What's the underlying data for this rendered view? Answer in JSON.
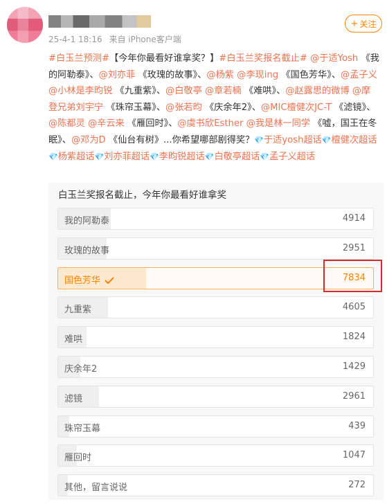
{
  "post": {
    "meta": {
      "date": "25-4-1 18:16",
      "source": "来自 iPhone客户端"
    },
    "follow_label": "关注",
    "content": [
      {
        "t": "tag",
        "v": "#白玉兰预测#"
      },
      {
        "t": "text",
        "v": "【今年你最看好谁拿奖？】"
      },
      {
        "t": "tag",
        "v": "#白玉兰奖报名截止#"
      },
      {
        "t": "text",
        "v": " "
      },
      {
        "t": "mention",
        "v": "@于适Yosh"
      },
      {
        "t": "text",
        "v": " 《我的阿勒泰》、"
      },
      {
        "t": "mention",
        "v": "@刘亦菲"
      },
      {
        "t": "text",
        "v": " 《玫瑰的故事》、"
      },
      {
        "t": "mention",
        "v": "@杨紫"
      },
      {
        "t": "text",
        "v": " "
      },
      {
        "t": "mention",
        "v": "@李现ing"
      },
      {
        "t": "text",
        "v": " 《国色芳华》、"
      },
      {
        "t": "mention",
        "v": "@孟子义"
      },
      {
        "t": "text",
        "v": " "
      },
      {
        "t": "mention",
        "v": "@小林是李昀锐"
      },
      {
        "t": "text",
        "v": " 《九重紫》、"
      },
      {
        "t": "mention",
        "v": "@白敬亭"
      },
      {
        "t": "text",
        "v": " "
      },
      {
        "t": "mention",
        "v": "@章若楠"
      },
      {
        "t": "text",
        "v": " 《难哄》、"
      },
      {
        "t": "mention",
        "v": "@赵露思的微博"
      },
      {
        "t": "text",
        "v": " "
      },
      {
        "t": "mention",
        "v": "@摩登兄弟刘宇宁"
      },
      {
        "t": "text",
        "v": " 《珠帘玉幕》、"
      },
      {
        "t": "mention",
        "v": "@张若昀"
      },
      {
        "t": "text",
        "v": " 《庆余年2》、"
      },
      {
        "t": "mention",
        "v": "@MIC檀健次JC-T"
      },
      {
        "t": "text",
        "v": " 《滤镜》、"
      },
      {
        "t": "mention",
        "v": "@陈都灵"
      },
      {
        "t": "text",
        "v": " "
      },
      {
        "t": "mention",
        "v": "@辛云来"
      },
      {
        "t": "text",
        "v": " 《雁回时》、"
      },
      {
        "t": "mention",
        "v": "@虞书欣Esther"
      },
      {
        "t": "text",
        "v": " "
      },
      {
        "t": "mention",
        "v": "@我是林一同学"
      },
      {
        "t": "text",
        "v": " 《嘘，国王在冬眠》、"
      },
      {
        "t": "mention",
        "v": "@邓为D"
      },
      {
        "t": "text",
        "v": " 《仙台有树》...你希望哪部剧得奖？"
      },
      {
        "t": "diamond",
        "v": "💎"
      },
      {
        "t": "mention",
        "v": "于适yosh超话"
      },
      {
        "t": "diamond",
        "v": "💎"
      },
      {
        "t": "mention",
        "v": "檀健次超话"
      },
      {
        "t": "diamond",
        "v": "💎"
      },
      {
        "t": "mention",
        "v": "杨紫超话"
      },
      {
        "t": "diamond",
        "v": "💎"
      },
      {
        "t": "mention",
        "v": "刘亦菲超话"
      },
      {
        "t": "diamond",
        "v": "💎"
      },
      {
        "t": "mention",
        "v": "李昀锐超话"
      },
      {
        "t": "diamond",
        "v": "💎"
      },
      {
        "t": "mention",
        "v": "白敬亭超话"
      },
      {
        "t": "diamond",
        "v": "💎"
      },
      {
        "t": "mention",
        "v": "孟子义超话"
      }
    ]
  },
  "poll": {
    "title": "白玉兰奖报名截止，今年你最看好谁拿奖",
    "options": [
      {
        "label": "我的阿勒泰",
        "count": "4914",
        "fraction": 0.168,
        "selected": false
      },
      {
        "label": "玫瑰的故事",
        "count": "2951",
        "fraction": 0.153,
        "selected": false
      },
      {
        "label": "国色芳华",
        "count": "7834",
        "fraction": 0.28,
        "selected": true
      },
      {
        "label": "九重紫",
        "count": "4605",
        "fraction": 0.158,
        "selected": false
      },
      {
        "label": "难哄",
        "count": "1824",
        "fraction": 0.09,
        "selected": false
      },
      {
        "label": "庆余年2",
        "count": "1429",
        "fraction": 0.07,
        "selected": false
      },
      {
        "label": "滤镜",
        "count": "2961",
        "fraction": 0.13,
        "selected": false
      },
      {
        "label": "珠帘玉幕",
        "count": "439",
        "fraction": 0.035,
        "selected": false
      },
      {
        "label": "雁回时",
        "count": "1047",
        "fraction": 0.06,
        "selected": false
      },
      {
        "label": "其他，留言说说",
        "count": "272",
        "fraction": 0.03,
        "selected": false
      }
    ]
  },
  "colors": {
    "accent": "#ff8200",
    "link": "#eb7350",
    "highlight": "#d42a2a"
  }
}
